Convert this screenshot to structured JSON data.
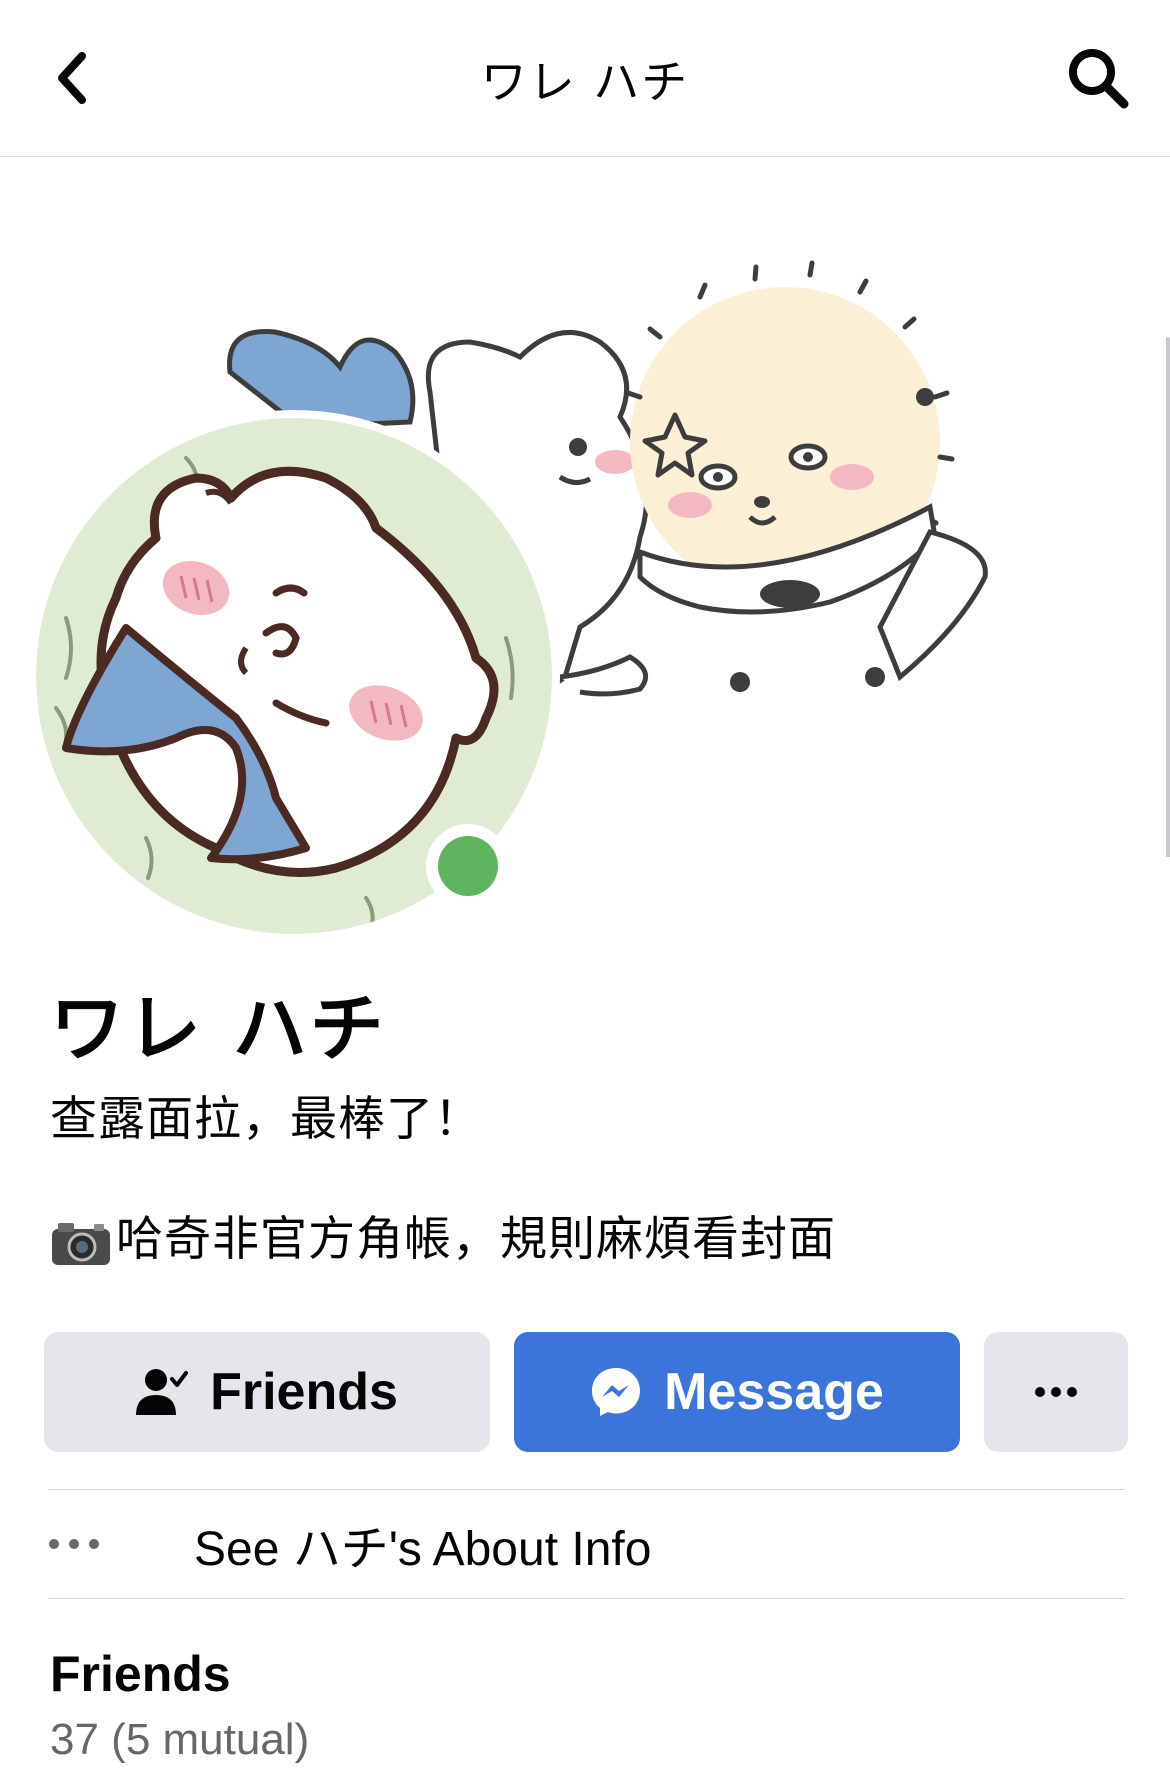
{
  "header": {
    "title": "ワレ ハチ",
    "back_icon": "chevron-left-icon",
    "search_icon": "search-icon"
  },
  "cover": {
    "description_icon": "cover-illustration"
  },
  "profile": {
    "name": "ワレ ハチ",
    "bio_line_1": "查露面拉，最棒了！",
    "bio_line_2": "哈奇非官方角帳，規則麻煩看封面",
    "bio_line_2_icon": "camera-emoji",
    "online": true,
    "online_color": "#5fb55f"
  },
  "actions": {
    "friends_label": "Friends",
    "friends_icon": "person-check-icon",
    "message_label": "Message",
    "message_icon": "messenger-icon",
    "more_icon": "more-dots-icon"
  },
  "about": {
    "label": "See ハチ's About Info",
    "icon": "more-dots-icon"
  },
  "friends_section": {
    "heading": "Friends",
    "count": "37 (5 mutual)"
  },
  "colors": {
    "primary_button": "#3b74db",
    "secondary_button": "#e4e6eb",
    "secondary_text": "#65676b"
  }
}
